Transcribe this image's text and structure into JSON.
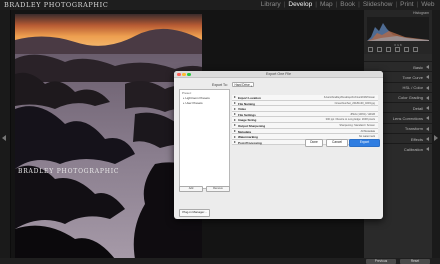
{
  "brand": "BRADLEY PHOTOGRAPHIC",
  "modules": [
    "Library",
    "Develop",
    "Map",
    "Book",
    "Slideshow",
    "Print",
    "Web"
  ],
  "active_module": "Develop",
  "right_panel": {
    "histogram_title": "Histogram",
    "histogram_values": "R   G   B",
    "panels": [
      "Basic",
      "Tone Curve",
      "HSL / Color",
      "Color Grading",
      "Detail",
      "Lens Corrections",
      "Transform",
      "Effects",
      "Calibration"
    ]
  },
  "bottom_buttons": {
    "previous": "Previous",
    "reset": "Reset"
  },
  "export_dialog": {
    "title": "Export One File",
    "export_to_label": "Export To:",
    "export_to_value": "Hard Drive",
    "preset_header": "Preset:",
    "presets": [
      "Lightroom Presets",
      "User Presets"
    ],
    "preset_add": "Add",
    "preset_remove": "Remove",
    "plugin_manager": "Plug-in Manager...",
    "sections": [
      {
        "name": "Export Location",
        "summary": "/Users/bradley/Desktop/Archive/2018/Ocean"
      },
      {
        "name": "File Naming",
        "summary": "OceanSunSet_20181130_0203.jpg"
      },
      {
        "name": "Video",
        "summary": ""
      },
      {
        "name": "File Settings",
        "summary": "JPEG (100%) / sRGB"
      },
      {
        "name": "Image Sizing",
        "summary": "300 ppi / Resize to Long Edge: 2048 pixels"
      },
      {
        "name": "Output Sharpening",
        "summary": "Sharpening: Standard / Screen"
      },
      {
        "name": "Metadata",
        "summary": "All Metadata"
      },
      {
        "name": "Watermarking",
        "summary": "No watermark"
      },
      {
        "name": "Post-Processing",
        "summary": "Show in Finder"
      }
    ],
    "buttons": {
      "done": "Done",
      "cancel": "Cancel",
      "export": "Export"
    }
  },
  "colors": {
    "accent": "#2f7de1",
    "sky": "#e58a3c",
    "background": "#141414"
  }
}
